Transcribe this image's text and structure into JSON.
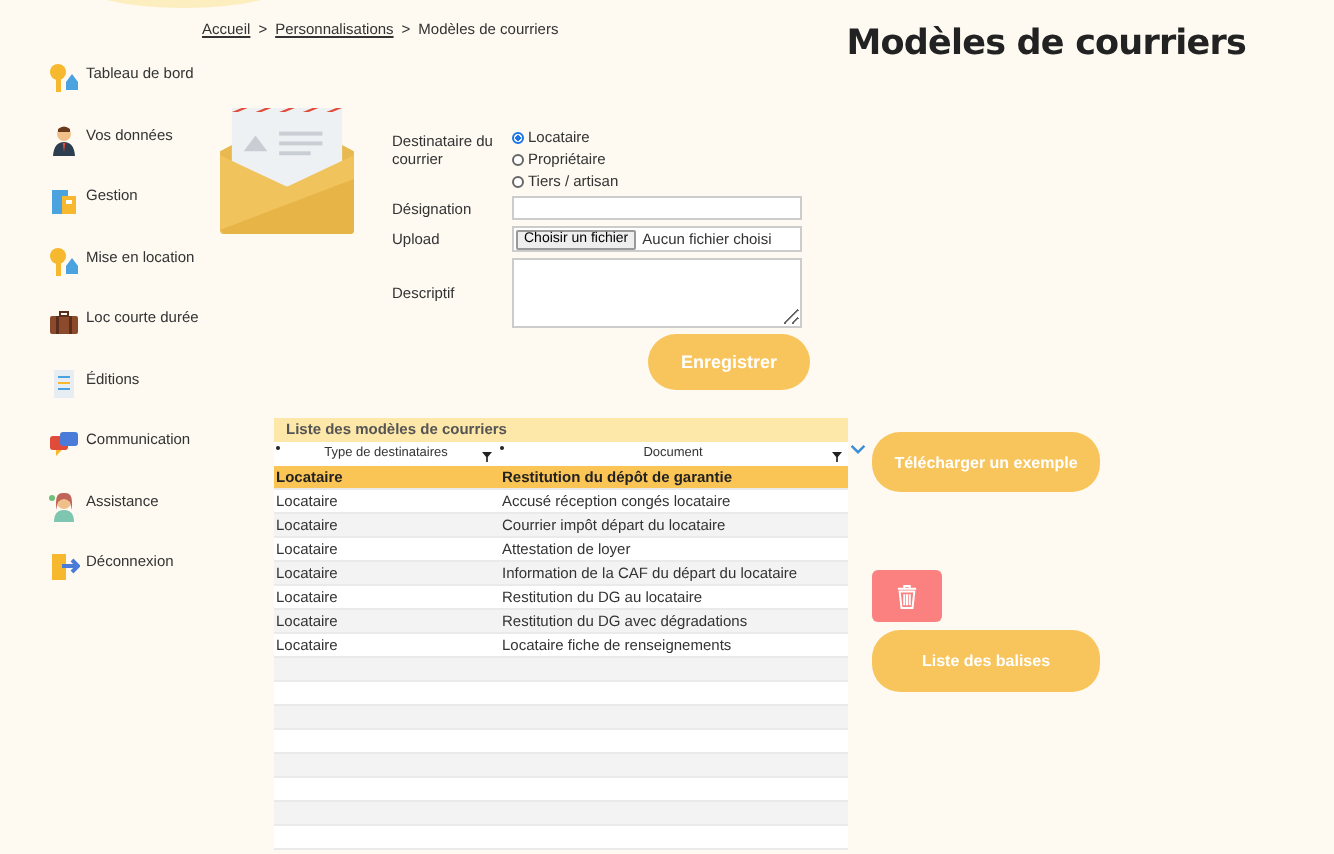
{
  "breadcrumb": {
    "separator": ">",
    "items": [
      {
        "label": "Accueil",
        "link": true
      },
      {
        "label": "Personnalisations",
        "link": true
      },
      {
        "label": "Modèles de courriers",
        "link": false
      }
    ]
  },
  "title": "Modèles de courriers",
  "sidebar": {
    "items": [
      {
        "label": "Tableau de bord",
        "kind": "key"
      },
      {
        "label": "Vos données",
        "kind": "person"
      },
      {
        "label": "Gestion",
        "kind": "building"
      },
      {
        "label": "Mise en location",
        "kind": "key"
      },
      {
        "label": "Loc courte durée",
        "kind": "suitcase"
      },
      {
        "label": "Éditions",
        "kind": "document"
      },
      {
        "label": "Communication",
        "kind": "chat"
      },
      {
        "label": "Assistance",
        "kind": "support"
      },
      {
        "label": "Déconnexion",
        "kind": "exit"
      }
    ]
  },
  "form": {
    "recipient": {
      "label": "Destinataire du courrier",
      "options": [
        {
          "label": "Locataire",
          "selected": true
        },
        {
          "label": "Propriétaire",
          "selected": false
        },
        {
          "label": "Tiers / artisan",
          "selected": false
        }
      ]
    },
    "designation": {
      "label": "Désignation"
    },
    "upload": {
      "label": "Upload",
      "button": "Choisir un fichier",
      "status": "Aucun fichier choisi"
    },
    "description": {
      "label": "Descriptif"
    },
    "save_button": "Enregistrer"
  },
  "table": {
    "title": "Liste des modèles de courriers",
    "columns": [
      "Type de destinataires",
      "Document"
    ],
    "rows": [
      {
        "cells": [
          "Locataire",
          "Restitution du dépôt de garantie"
        ],
        "selected": true
      },
      {
        "cells": [
          "Locataire",
          "Accusé réception congés locataire"
        ],
        "selected": false
      },
      {
        "cells": [
          "Locataire",
          "Courrier impôt départ du locataire"
        ],
        "selected": false
      },
      {
        "cells": [
          "Locataire",
          "Attestation de loyer"
        ],
        "selected": false
      },
      {
        "cells": [
          "Locataire",
          "Information de la CAF du départ du locataire"
        ],
        "selected": false
      },
      {
        "cells": [
          "Locataire",
          "Restitution du DG au locataire"
        ],
        "selected": false
      },
      {
        "cells": [
          "Locataire",
          "Restitution du DG avec dégradations"
        ],
        "selected": false
      },
      {
        "cells": [
          "Locataire",
          "Locataire fiche de renseignements"
        ],
        "selected": false
      }
    ]
  },
  "buttons": {
    "download_example": "Télécharger un exemple",
    "list_tags": "Liste des balises"
  }
}
